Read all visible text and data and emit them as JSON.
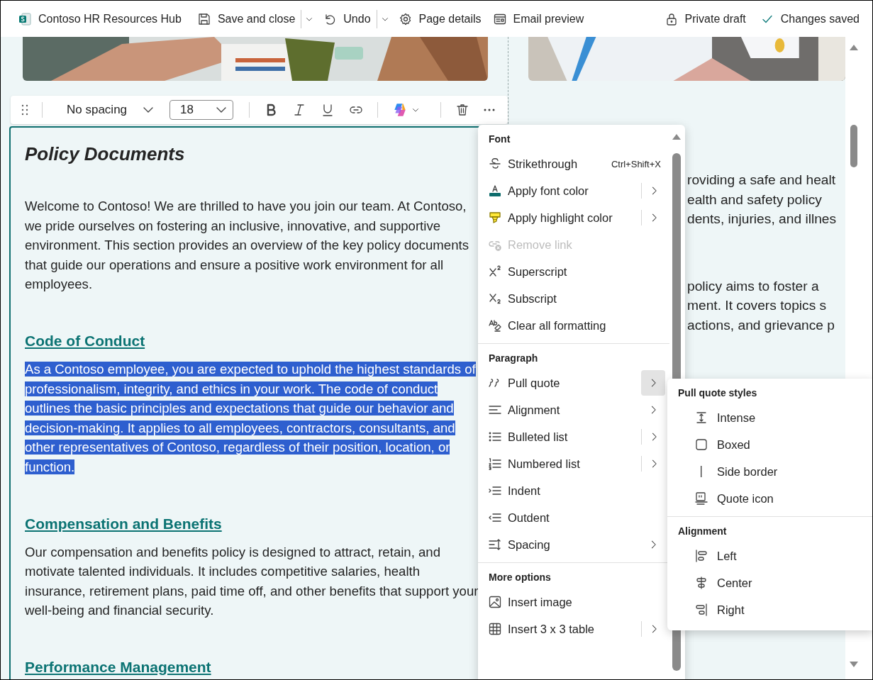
{
  "top_bar": {
    "site_title": "Contoso HR Resources Hub",
    "buttons": [
      {
        "label": "Save and close",
        "dropdown": true
      },
      {
        "label": "Undo",
        "dropdown": true
      },
      {
        "label": "Page details",
        "dropdown": false
      },
      {
        "label": "Email preview",
        "dropdown": false
      }
    ],
    "status": [
      {
        "label": "Private draft"
      },
      {
        "label": "Changes saved"
      }
    ]
  },
  "format_toolbar": {
    "style": "No spacing",
    "size": "18"
  },
  "editor": {
    "title": "Policy Documents",
    "blocks": [
      {
        "kind": "paragraph",
        "text": "Welcome to Contoso! We are thrilled to have you join our team. At Contoso, we pride ourselves on fostering an inclusive, innovative, and supportive environment. This section provides an overview of the key policy documents that guide our operations and ensure a positive work environment for all employees.",
        "selected": false
      },
      {
        "kind": "heading",
        "text": "Code of Conduct"
      },
      {
        "kind": "paragraph",
        "text": "As a Contoso employee, you are expected to uphold the highest standards of professionalism, integrity, and ethics in your work. The code of conduct outlines the basic principles and expectations that guide our behavior and decision-making. It applies to all employees, contractors, consultants, and other representatives of Contoso, regardless of their position, location, or function.",
        "selected": true
      },
      {
        "kind": "heading",
        "text": "Compensation and Benefits"
      },
      {
        "kind": "paragraph",
        "text": "Our compensation and benefits policy is designed to attract, retain, and motivate talented individuals. It includes competitive salaries, health insurance, retirement plans, paid time off, and other benefits that support your well-being and financial security.",
        "selected": false
      },
      {
        "kind": "heading",
        "text": "Performance Management"
      }
    ]
  },
  "right_column": {
    "paragraphs": [
      [
        "roviding a safe and healt",
        "ealth and safety policy",
        "dents, injuries, and illnes"
      ],
      [
        "policy aims to foster a",
        "ment. It covers topics s",
        "actions, and grievance p"
      ]
    ]
  },
  "context_menu": {
    "sections": [
      {
        "title": "Font",
        "items": [
          {
            "label": "Strikethrough",
            "shortcut": "Ctrl+Shift+X",
            "submenu": false,
            "disabled": false
          },
          {
            "label": "Apply font color",
            "submenu": true,
            "split": true,
            "disabled": false,
            "expanded": false
          },
          {
            "label": "Apply highlight color",
            "submenu": true,
            "split": true,
            "disabled": false,
            "expanded": false
          },
          {
            "label": "Remove link",
            "submenu": false,
            "disabled": true
          },
          {
            "label": "Superscript",
            "submenu": false,
            "disabled": false
          },
          {
            "label": "Subscript",
            "submenu": false,
            "disabled": false
          },
          {
            "label": "Clear all formatting",
            "submenu": false,
            "disabled": false
          }
        ]
      },
      {
        "title": "Paragraph",
        "items": [
          {
            "label": "Pull quote",
            "submenu": true,
            "split": true,
            "disabled": false,
            "expanded": true
          },
          {
            "label": "Alignment",
            "submenu": true,
            "split": false,
            "disabled": false,
            "expanded": false
          },
          {
            "label": "Bulleted list",
            "submenu": true,
            "split": true,
            "disabled": false,
            "expanded": false
          },
          {
            "label": "Numbered list",
            "submenu": true,
            "split": true,
            "disabled": false,
            "expanded": false
          },
          {
            "label": "Indent",
            "submenu": false,
            "disabled": false
          },
          {
            "label": "Outdent",
            "submenu": false,
            "disabled": false
          },
          {
            "label": "Spacing",
            "submenu": true,
            "split": false,
            "disabled": false,
            "expanded": false
          }
        ]
      },
      {
        "title": "More options",
        "items": [
          {
            "label": "Insert image",
            "submenu": false,
            "disabled": false
          },
          {
            "label": "Insert 3 x 3 table",
            "submenu": true,
            "split": true,
            "disabled": false,
            "expanded": false
          }
        ]
      }
    ]
  },
  "submenu": {
    "sections": [
      {
        "title": "Pull quote styles",
        "items": [
          {
            "label": "Intense"
          },
          {
            "label": "Boxed"
          },
          {
            "label": "Side border"
          },
          {
            "label": "Quote icon"
          }
        ]
      },
      {
        "title": "Alignment",
        "items": [
          {
            "label": "Left"
          },
          {
            "label": "Center"
          },
          {
            "label": "Right"
          }
        ]
      }
    ]
  }
}
